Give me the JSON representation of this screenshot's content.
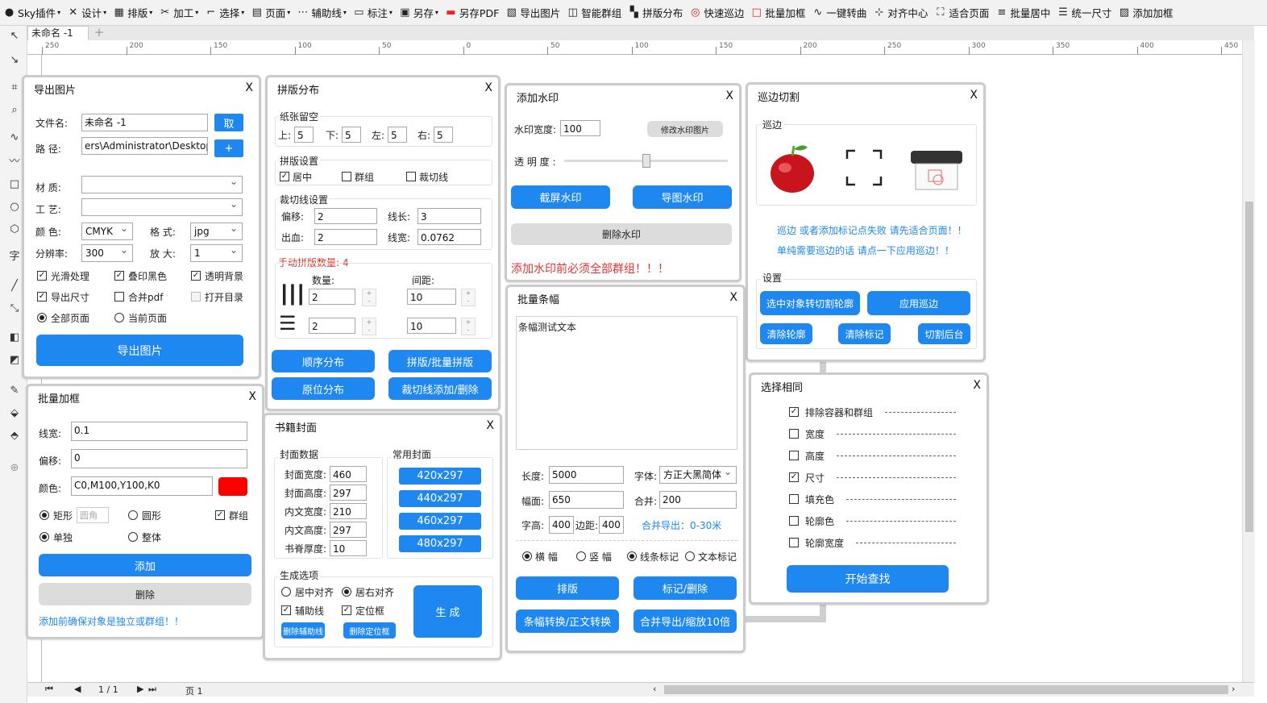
{
  "toolbar": [
    {
      "icon": "●",
      "label": "Sky插件",
      "dd": true
    },
    {
      "icon": "✕",
      "label": "设计",
      "dd": true
    },
    {
      "icon": "▦",
      "label": "排版",
      "dd": true
    },
    {
      "icon": "✂",
      "label": "加工",
      "dd": true
    },
    {
      "icon": "⌐",
      "label": "选择",
      "dd": true
    },
    {
      "icon": "▤",
      "label": "页面",
      "dd": true
    },
    {
      "icon": "⋯",
      "label": "辅助线",
      "dd": true
    },
    {
      "icon": "▭",
      "label": "标注",
      "dd": true
    },
    {
      "icon": "▣",
      "label": "另存",
      "dd": true
    },
    {
      "icon": "▬",
      "label": "另存PDF",
      "dd": false
    },
    {
      "icon": "▧",
      "label": "导出图片",
      "dd": false
    },
    {
      "icon": "◫",
      "label": "智能群组",
      "dd": false
    },
    {
      "icon": "▚",
      "label": "拼版分布",
      "dd": false
    },
    {
      "icon": "◎",
      "label": "快速巡边",
      "dd": false
    },
    {
      "icon": "□",
      "label": "批量加框",
      "dd": false
    },
    {
      "icon": "∿",
      "label": "一键转曲",
      "dd": false
    },
    {
      "icon": "⊹",
      "label": "对齐中心",
      "dd": false
    },
    {
      "icon": "⛶",
      "label": "适合页面",
      "dd": false
    },
    {
      "icon": "≡",
      "label": "批量居中",
      "dd": false
    },
    {
      "icon": "☰",
      "label": "统一尺寸",
      "dd": false
    },
    {
      "icon": "▨",
      "label": "添加加框",
      "dd": false
    }
  ],
  "doc_tab": "未命名 -1",
  "ruler_ticks": [
    "250",
    "200",
    "150",
    "100",
    "50",
    "0",
    "50",
    "100",
    "150",
    "200",
    "250",
    "300",
    "350",
    "400",
    "450"
  ],
  "bottom": {
    "page_count": "1 / 1",
    "page_tab": "页 1"
  },
  "export": {
    "title": "导出图片",
    "close": "X",
    "filename_label": "文件名:",
    "filename": "未命名 -1",
    "take_btn": "取",
    "path_label": "路  径:",
    "path": "ers\\Administrator\\Desktop",
    "plus_btn": "+",
    "material_label": "材  质:",
    "craft_label": "工  艺:",
    "color_label": "颜  色:",
    "color_value": "CMYK",
    "format_label": "格  式:",
    "format_value": "jpg",
    "res_label": "分辨率:",
    "res_value": "300",
    "zoom_label": "放  大:",
    "zoom_value": "1",
    "smooth": "光滑处理",
    "black": "叠印黑色",
    "transparent": "透明背景",
    "export_size": "导出尺寸",
    "merge_pdf": "合并pdf",
    "open_dir": "打开目录",
    "all_pages": "全部页面",
    "current_page": "当前页面",
    "export_btn": "导出图片"
  },
  "layout": {
    "title": "拼版分布",
    "close": "X",
    "margin_group": "纸张留空",
    "top_label": "上:",
    "top": "5",
    "bottom_label": "下:",
    "bottom": "5",
    "left_label": "左:",
    "left": "5",
    "right_label": "右:",
    "right": "5",
    "settings_group": "拼版设置",
    "center": "居中",
    "group": "群组",
    "cutline": "裁切线",
    "cut_group": "裁切线设置",
    "offset_label": "偏移:",
    "offset": "2",
    "length_label": "线长:",
    "length": "3",
    "bleed_label": "出血:",
    "bleed": "2",
    "width_label": "线宽:",
    "width": "0.0762",
    "manual_label": "手动拼版数量: 4",
    "count_label": "数量:",
    "gap_label": "间距:",
    "count1": "2",
    "gap1": "10",
    "count2": "2",
    "gap2": "10",
    "btn_seq": "顺序分布",
    "btn_batch": "拼版/批量拼版",
    "btn_orig": "原位分布",
    "btn_cut": "裁切线添加/删除"
  },
  "watermark": {
    "title": "添加水印",
    "close": "X",
    "width_label": "水印宽度:",
    "width": "100",
    "change_img": "修改水印图片",
    "opacity_label": "透 明 度 :",
    "opacity": 0.5,
    "btn_screen": "截屏水印",
    "btn_image": "导图水印",
    "btn_delete": "删除水印",
    "warning": "添加水印前必须全部群组！！！"
  },
  "contour": {
    "title": "巡边切割",
    "close": "X",
    "group": "巡边",
    "tip1": "巡边 或者添加标记点失败 请先适合页面！！",
    "tip2": "单纯需要巡边的话 请点一下应用巡边！！",
    "settings": "设置",
    "btn_convert": "选中对象转切割轮廓",
    "btn_apply": "应用巡边",
    "btn_clear_outline": "清除轮廓",
    "btn_clear_mark": "清除标记",
    "btn_cut": "切割后台"
  },
  "frame": {
    "title": "批量加框",
    "close": "X",
    "line_label": "线宽:",
    "line": "0.1",
    "offset_label": "偏移:",
    "offset": "0",
    "color_label": "颜色:",
    "color_value": "C0,M100,Y100,K0",
    "swatch": "#ff0000",
    "rect": "矩形",
    "corner": "圆角",
    "circle": "圆形",
    "group": "群组",
    "single": "单独",
    "whole": "整体",
    "add_btn": "添加",
    "del_btn": "删除",
    "note": "添加前确保对象是独立或群组！！"
  },
  "cover": {
    "title": "书籍封面",
    "close": "X",
    "data_group": "封面数据",
    "w_label": "封面宽度:",
    "w": "460",
    "h_label": "封面高度:",
    "h": "297",
    "iw_label": "内文宽度:",
    "iw": "210",
    "ih_label": "内文高度:",
    "ih": "297",
    "spine_label": "书脊厚度:",
    "spine": "10",
    "common_group": "常用封面",
    "sizes": [
      "420x297",
      "440x297",
      "460x297",
      "480x297"
    ],
    "gen_group": "生成选项",
    "center_align": "居中对齐",
    "right_align": "居右对齐",
    "guides": "辅助线",
    "marks": "定位框",
    "btn_gen": "生 成",
    "btn_del_guides": "删除辅助线",
    "btn_del_marks": "删除定位框"
  },
  "banner": {
    "title": "批量条幅",
    "close": "X",
    "text": "条幅测试文本",
    "length_label": "长度:",
    "length": "5000",
    "font_label": "字体:",
    "font": "方正大黑简体",
    "width_label": "幅面:",
    "width": "650",
    "merge_label": "合并:",
    "merge": "200",
    "char_label": "字高:",
    "char": "400",
    "margin_label": "边距:",
    "margin": "400",
    "merge_export": "合并导出：0-30米",
    "horizontal": "横 幅",
    "vertical": "竖 幅",
    "line_mark": "线条标记",
    "text_mark": "文本标记",
    "btn_layout": "排版",
    "btn_mark": "标记/删除",
    "btn_convert": "条幅转换/正文转换",
    "btn_merge": "合并导出/缩放10倍"
  },
  "similar": {
    "title": "选择相同",
    "close": "X",
    "items": [
      {
        "label": "排除容器和群组",
        "checked": true
      },
      {
        "label": "宽度",
        "checked": false
      },
      {
        "label": "高度",
        "checked": false
      },
      {
        "label": "尺寸",
        "checked": true
      },
      {
        "label": "填充色",
        "checked": false
      },
      {
        "label": "轮廓色",
        "checked": false
      },
      {
        "label": "轮廓宽度",
        "checked": false
      }
    ],
    "btn": "开始查找"
  }
}
